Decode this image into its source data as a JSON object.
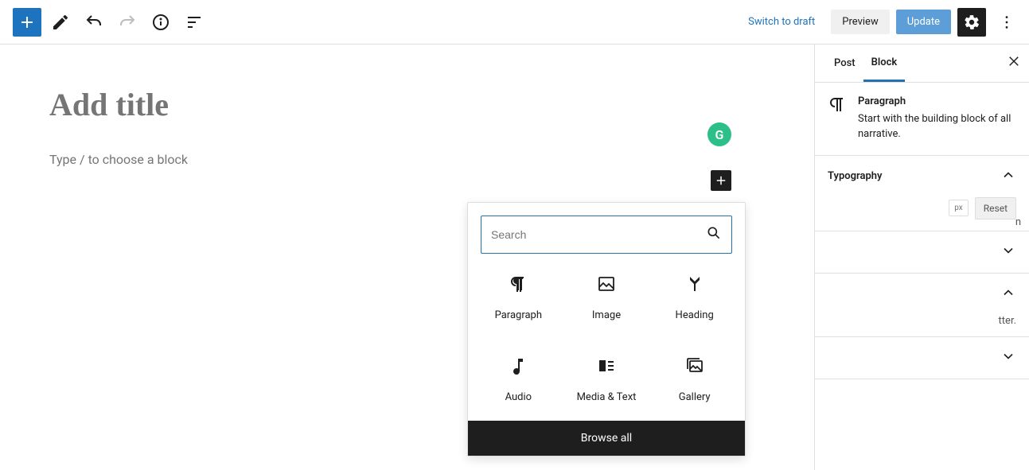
{
  "toolbar": {
    "switch_to_draft": "Switch to draft",
    "preview": "Preview",
    "update": "Update"
  },
  "editor": {
    "title_placeholder": "Add title",
    "block_placeholder": "Type / to choose a block"
  },
  "inserter": {
    "search_placeholder": "Search",
    "blocks": {
      "paragraph": "Paragraph",
      "image": "Image",
      "heading": "Heading",
      "audio": "Audio",
      "media_text": "Media & Text",
      "gallery": "Gallery"
    },
    "browse_all": "Browse all"
  },
  "sidebar": {
    "tabs": {
      "post": "Post",
      "block": "Block"
    },
    "block_info": {
      "title": "Paragraph",
      "desc": "Start with the building block of all narrative."
    },
    "panels": {
      "typography": "Typography",
      "px": "px",
      "reset": "Reset",
      "hint_tter": "tter.",
      "n": "n"
    }
  }
}
